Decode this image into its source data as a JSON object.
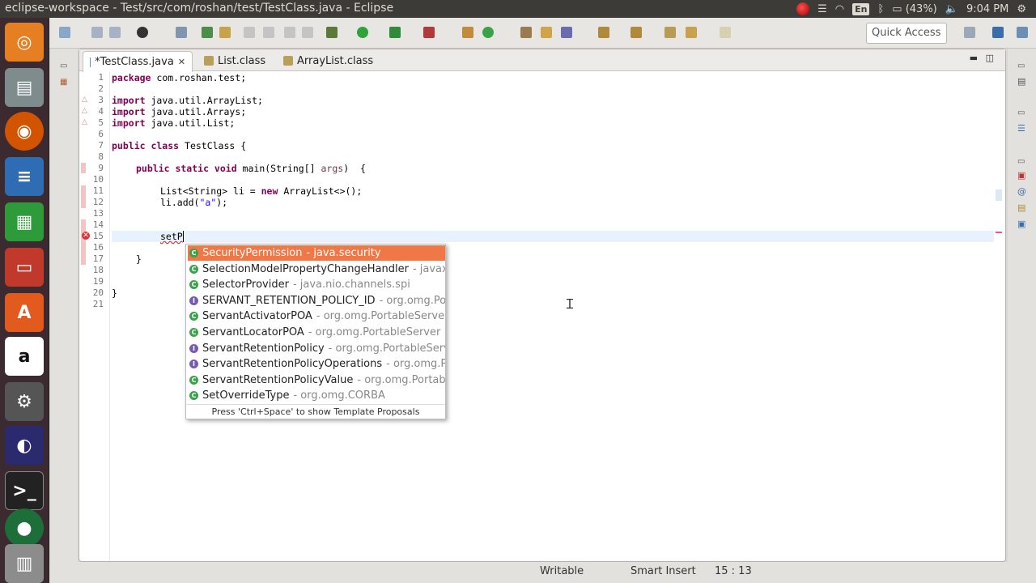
{
  "window": {
    "title": "eclipse-workspace - Test/src/com/roshan/test/TestClass.java - Eclipse"
  },
  "tray": {
    "lang": "En",
    "battery": "(43%)",
    "time": "9:04 PM"
  },
  "toolbar": {
    "quick_access": "Quick Access"
  },
  "tabs": [
    {
      "label": "*TestClass.java",
      "icon": "java-file-icon",
      "closable": true
    },
    {
      "label": "List.class",
      "icon": "class-file-icon"
    },
    {
      "label": "ArrayList.class",
      "icon": "class-file-icon"
    }
  ],
  "editor": {
    "lines": [
      "1",
      "2",
      "3",
      "4",
      "5",
      "6",
      "7",
      "8",
      "9",
      "10",
      "11",
      "12",
      "13",
      "14",
      "15",
      "16",
      "17",
      "18",
      "19",
      "20",
      "21"
    ],
    "code": {
      "l1": "package com.roshan.test;",
      "l3": "import java.util.ArrayList;",
      "l4": "import java.util.Arrays;",
      "l5": "import java.util.List;",
      "l7a": "public class",
      "l7b": " TestClass {",
      "l9a": "public static void",
      "l9b": " main(String[] ",
      "l9c": "args",
      "l9d": ")  {",
      "l11a": "List<String> li = ",
      "l11b": "new",
      "l11c": " ArrayList<>();",
      "l12a": "li.add(",
      "l12b": "\"a\"",
      "l12c": ");",
      "l15": "setP",
      "l17": "}",
      "l20": "}"
    }
  },
  "autocomplete": {
    "items": [
      {
        "name": "SecurityPermission",
        "pkg": " - java.security",
        "icon": "class-icon"
      },
      {
        "name": "SelectionModelPropertyChangeHandler",
        "pkg": " - javax",
        "icon": "class-icon"
      },
      {
        "name": "SelectorProvider",
        "pkg": " - java.nio.channels.spi",
        "icon": "class-icon"
      },
      {
        "name": "SERVANT_RETENTION_POLICY_ID",
        "pkg": " - org.omg.Po",
        "icon": "interface-icon"
      },
      {
        "name": "ServantActivatorPOA",
        "pkg": " - org.omg.PortableServe",
        "icon": "class-icon"
      },
      {
        "name": "ServantLocatorPOA",
        "pkg": " - org.omg.PortableServer",
        "icon": "class-icon"
      },
      {
        "name": "ServantRetentionPolicy",
        "pkg": " - org.omg.PortableServ",
        "icon": "interface-icon"
      },
      {
        "name": "ServantRetentionPolicyOperations",
        "pkg": " - org.omg.P",
        "icon": "interface-icon"
      },
      {
        "name": "ServantRetentionPolicyValue",
        "pkg": " - org.omg.Portab",
        "icon": "class-icon"
      },
      {
        "name": "SetOverrideType",
        "pkg": " - org.omg.CORBA",
        "icon": "class-icon"
      }
    ],
    "hint": "Press 'Ctrl+Space' to show Template Proposals"
  },
  "status": {
    "mode": "Writable",
    "insert": "Smart Insert",
    "position": "15 : 13"
  },
  "colors": {
    "selection": "#f07746",
    "keyword": "#7f0055",
    "string": "#2a00ff"
  }
}
